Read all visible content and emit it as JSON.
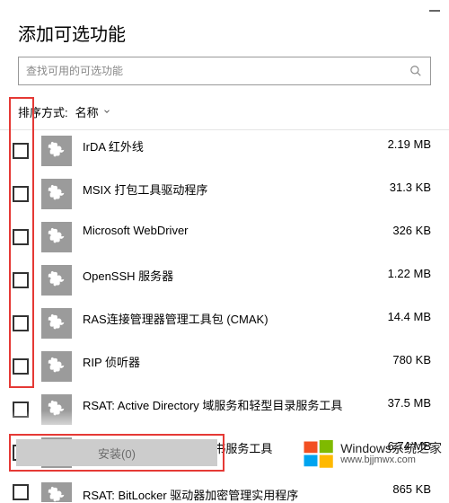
{
  "window": {
    "title": "添加可选功能"
  },
  "search": {
    "placeholder": "查找可用的可选功能"
  },
  "sort": {
    "label": "排序方式:",
    "value": "名称"
  },
  "features": [
    {
      "name": "IrDA 红外线",
      "size": "2.19 MB"
    },
    {
      "name": "MSIX 打包工具驱动程序",
      "size": "31.3 KB"
    },
    {
      "name": "Microsoft WebDriver",
      "size": "326 KB"
    },
    {
      "name": "OpenSSH 服务器",
      "size": "1.22 MB"
    },
    {
      "name": "RAS连接管理器管理工具包 (CMAK)",
      "size": "14.4 MB"
    },
    {
      "name": "RIP 侦听器",
      "size": "780 KB"
    },
    {
      "name": "RSAT: Active Directory 域服务和轻型目录服务工具",
      "size": "37.5 MB"
    },
    {
      "name": "RSAT: Active Directory 证书服务工具",
      "size": "6.74 MB"
    },
    {
      "name": "RSAT: BitLocker 驱动器加密管理实用程序",
      "size": "865 KB"
    }
  ],
  "install": {
    "label": "安装(0)"
  },
  "watermark": {
    "line1": "Windows系统之家",
    "domain": "www.bjjmwx.com"
  },
  "colors": {
    "highlight": "#e53935",
    "icon_bg": "#9b9b9b",
    "disabled_btn": "#cccccc"
  }
}
